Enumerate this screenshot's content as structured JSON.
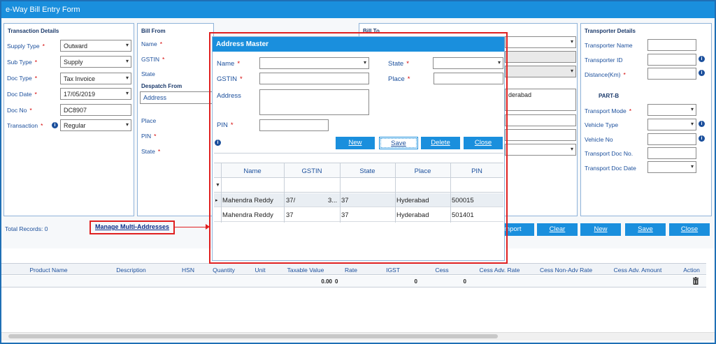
{
  "window": {
    "title": "e-Way Bill Entry Form"
  },
  "transaction": {
    "title": "Transaction Details",
    "supply_type_label": "Supply Type",
    "supply_type": "Outward",
    "sub_type_label": "Sub Type",
    "sub_type": "Supply",
    "doc_type_label": "Doc Type",
    "doc_type": "Tax Invoice",
    "doc_date_label": "Doc Date",
    "doc_date": "17/05/2019",
    "doc_no_label": "Doc No",
    "doc_no": "DC8907",
    "transaction_label": "Transaction",
    "transaction": "Regular"
  },
  "bill_from": {
    "title": "Bill From",
    "name_label": "Name",
    "gstin_label": "GSTIN",
    "state_label": "State",
    "despatch_title": "Despatch From",
    "address_placeholder": "Address",
    "place_label": "Place",
    "pin_label": "PIN",
    "state2_label": "State"
  },
  "bill_to": {
    "title": "Bill To",
    "address_value": "derabad"
  },
  "transporter": {
    "title": "Transporter Details",
    "name_label": "Transporter Name",
    "id_label": "Transporter ID",
    "distance_label": "Distance(Km)",
    "partb_title": "PART-B",
    "mode_label": "Transport Mode",
    "vehicle_type_label": "Vehicle Type",
    "vehicle_no_label": "Vehicle No",
    "doc_no_label": "Transport Doc No.",
    "doc_date_label": "Transport Doc Date"
  },
  "footer": {
    "total_records": "Total Records: 0",
    "manage_link": "Manage Multi-Addresses",
    "import_label": "Import",
    "clear_label": "Clear",
    "new_label": "New",
    "save_label": "Save",
    "close_label": "Close"
  },
  "items_grid": {
    "headers": [
      "Product Name",
      "Description",
      "HSN",
      "Quantity",
      "Unit",
      "Taxable Value",
      "Rate",
      "IGST",
      "Cess",
      "Cess Adv. Rate",
      "Cess Non-Adv Rate",
      "Cess Adv. Amount",
      "Action"
    ],
    "taxable_value": "0.00",
    "rate": "0",
    "igst": "0",
    "cess": "0"
  },
  "modal": {
    "title": "Address Master",
    "name_label": "Name",
    "state_label": "State",
    "gstin_label": "GSTIN",
    "place_label": "Place",
    "address_label": "Address",
    "pin_label": "PIN",
    "new_label": "New",
    "save_label": "Save",
    "delete_label": "Delete",
    "close_label": "Close",
    "columns": [
      "Name",
      "GSTIN",
      "State",
      "Place",
      "PIN"
    ],
    "rows": [
      {
        "name": "Mahendra Reddy",
        "gstin": "37/",
        "gstin_tail": "3...",
        "state": "37",
        "place": "Hyderabad",
        "pin": "500015"
      },
      {
        "name": "Mahendra Reddy",
        "gstin": "37",
        "gstin_tail": "",
        "state": "37",
        "place": "Hyderabad",
        "pin": "501401"
      }
    ]
  },
  "colors": {
    "accent": "#1a8fdd",
    "highlight": "#e02020",
    "label": "#1b4f9c"
  }
}
